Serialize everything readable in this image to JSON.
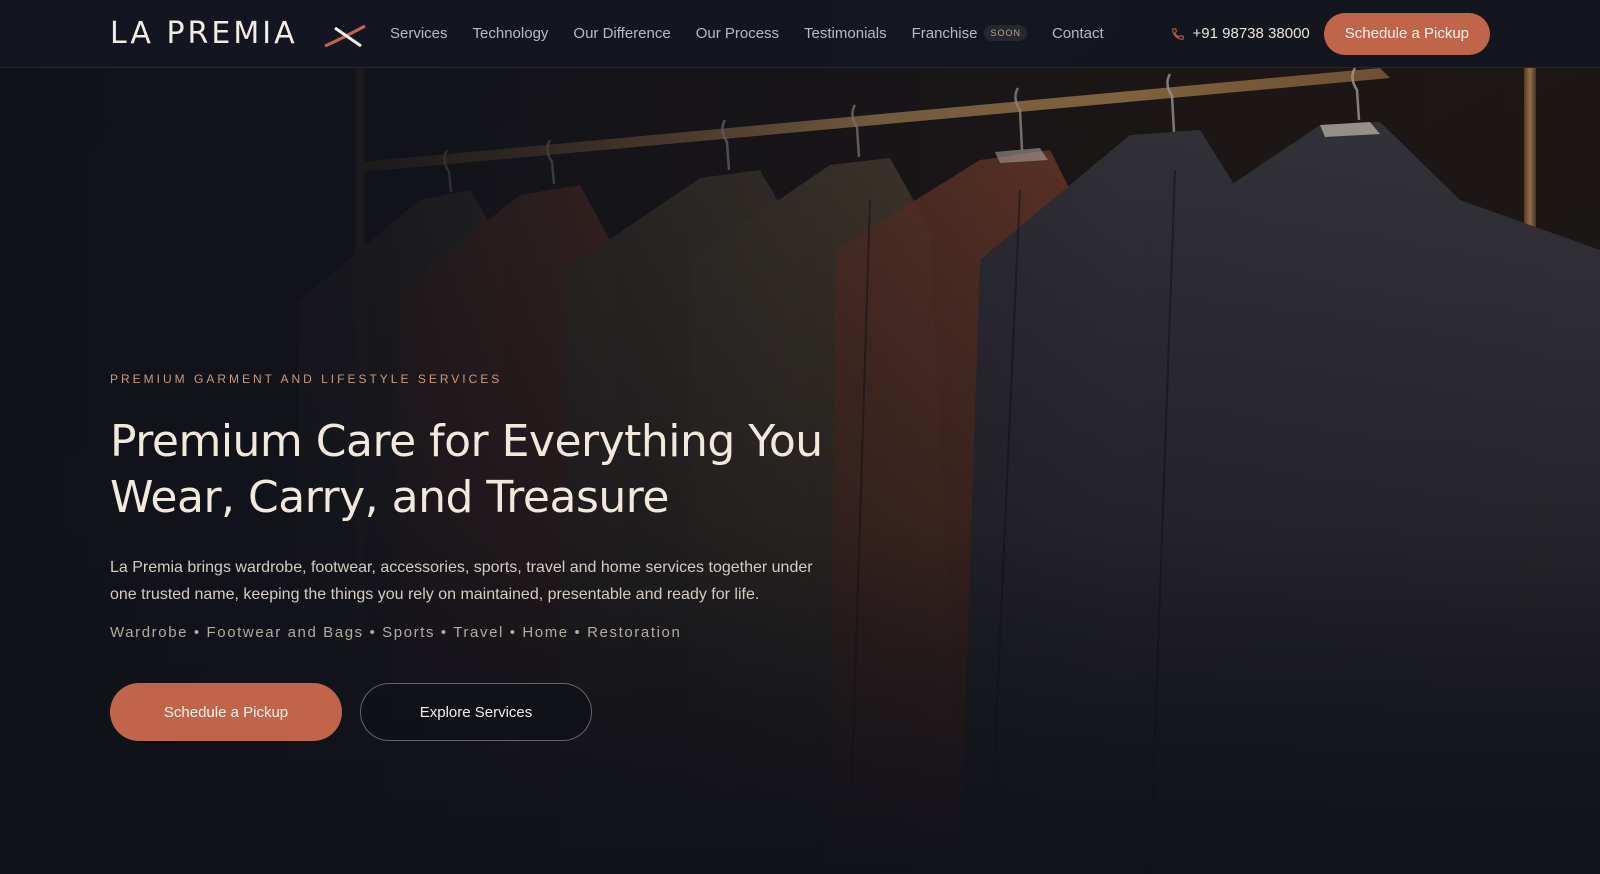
{
  "brand": {
    "logo_text": "LA PREMIA",
    "accent": "#c0654a",
    "background": "#12151d"
  },
  "nav": {
    "links": [
      "Services",
      "Technology",
      "Our Difference",
      "Our Process",
      "Testimonials",
      "Franchise",
      "Contact"
    ],
    "franchise_badge": "SOON",
    "phone_icon": "phone-icon",
    "phone": "+91 98738 38000",
    "cta": "Schedule a Pickup"
  },
  "hero": {
    "eyebrow": "PREMIUM GARMENT AND LIFESTYLE SERVICES",
    "headline": "Premium Care for Everything You Wear, Carry, and Treasure",
    "description": "La Premia brings wardrobe, footwear, accessories, sports, travel and home services together under one trusted name, keeping the things you rely on maintained, presentable and ready for life.",
    "categories": "Wardrobe • Footwear and Bags • Sports • Travel • Home • Restoration",
    "primary_cta": "Schedule a Pickup",
    "secondary_cta": "Explore Services"
  }
}
